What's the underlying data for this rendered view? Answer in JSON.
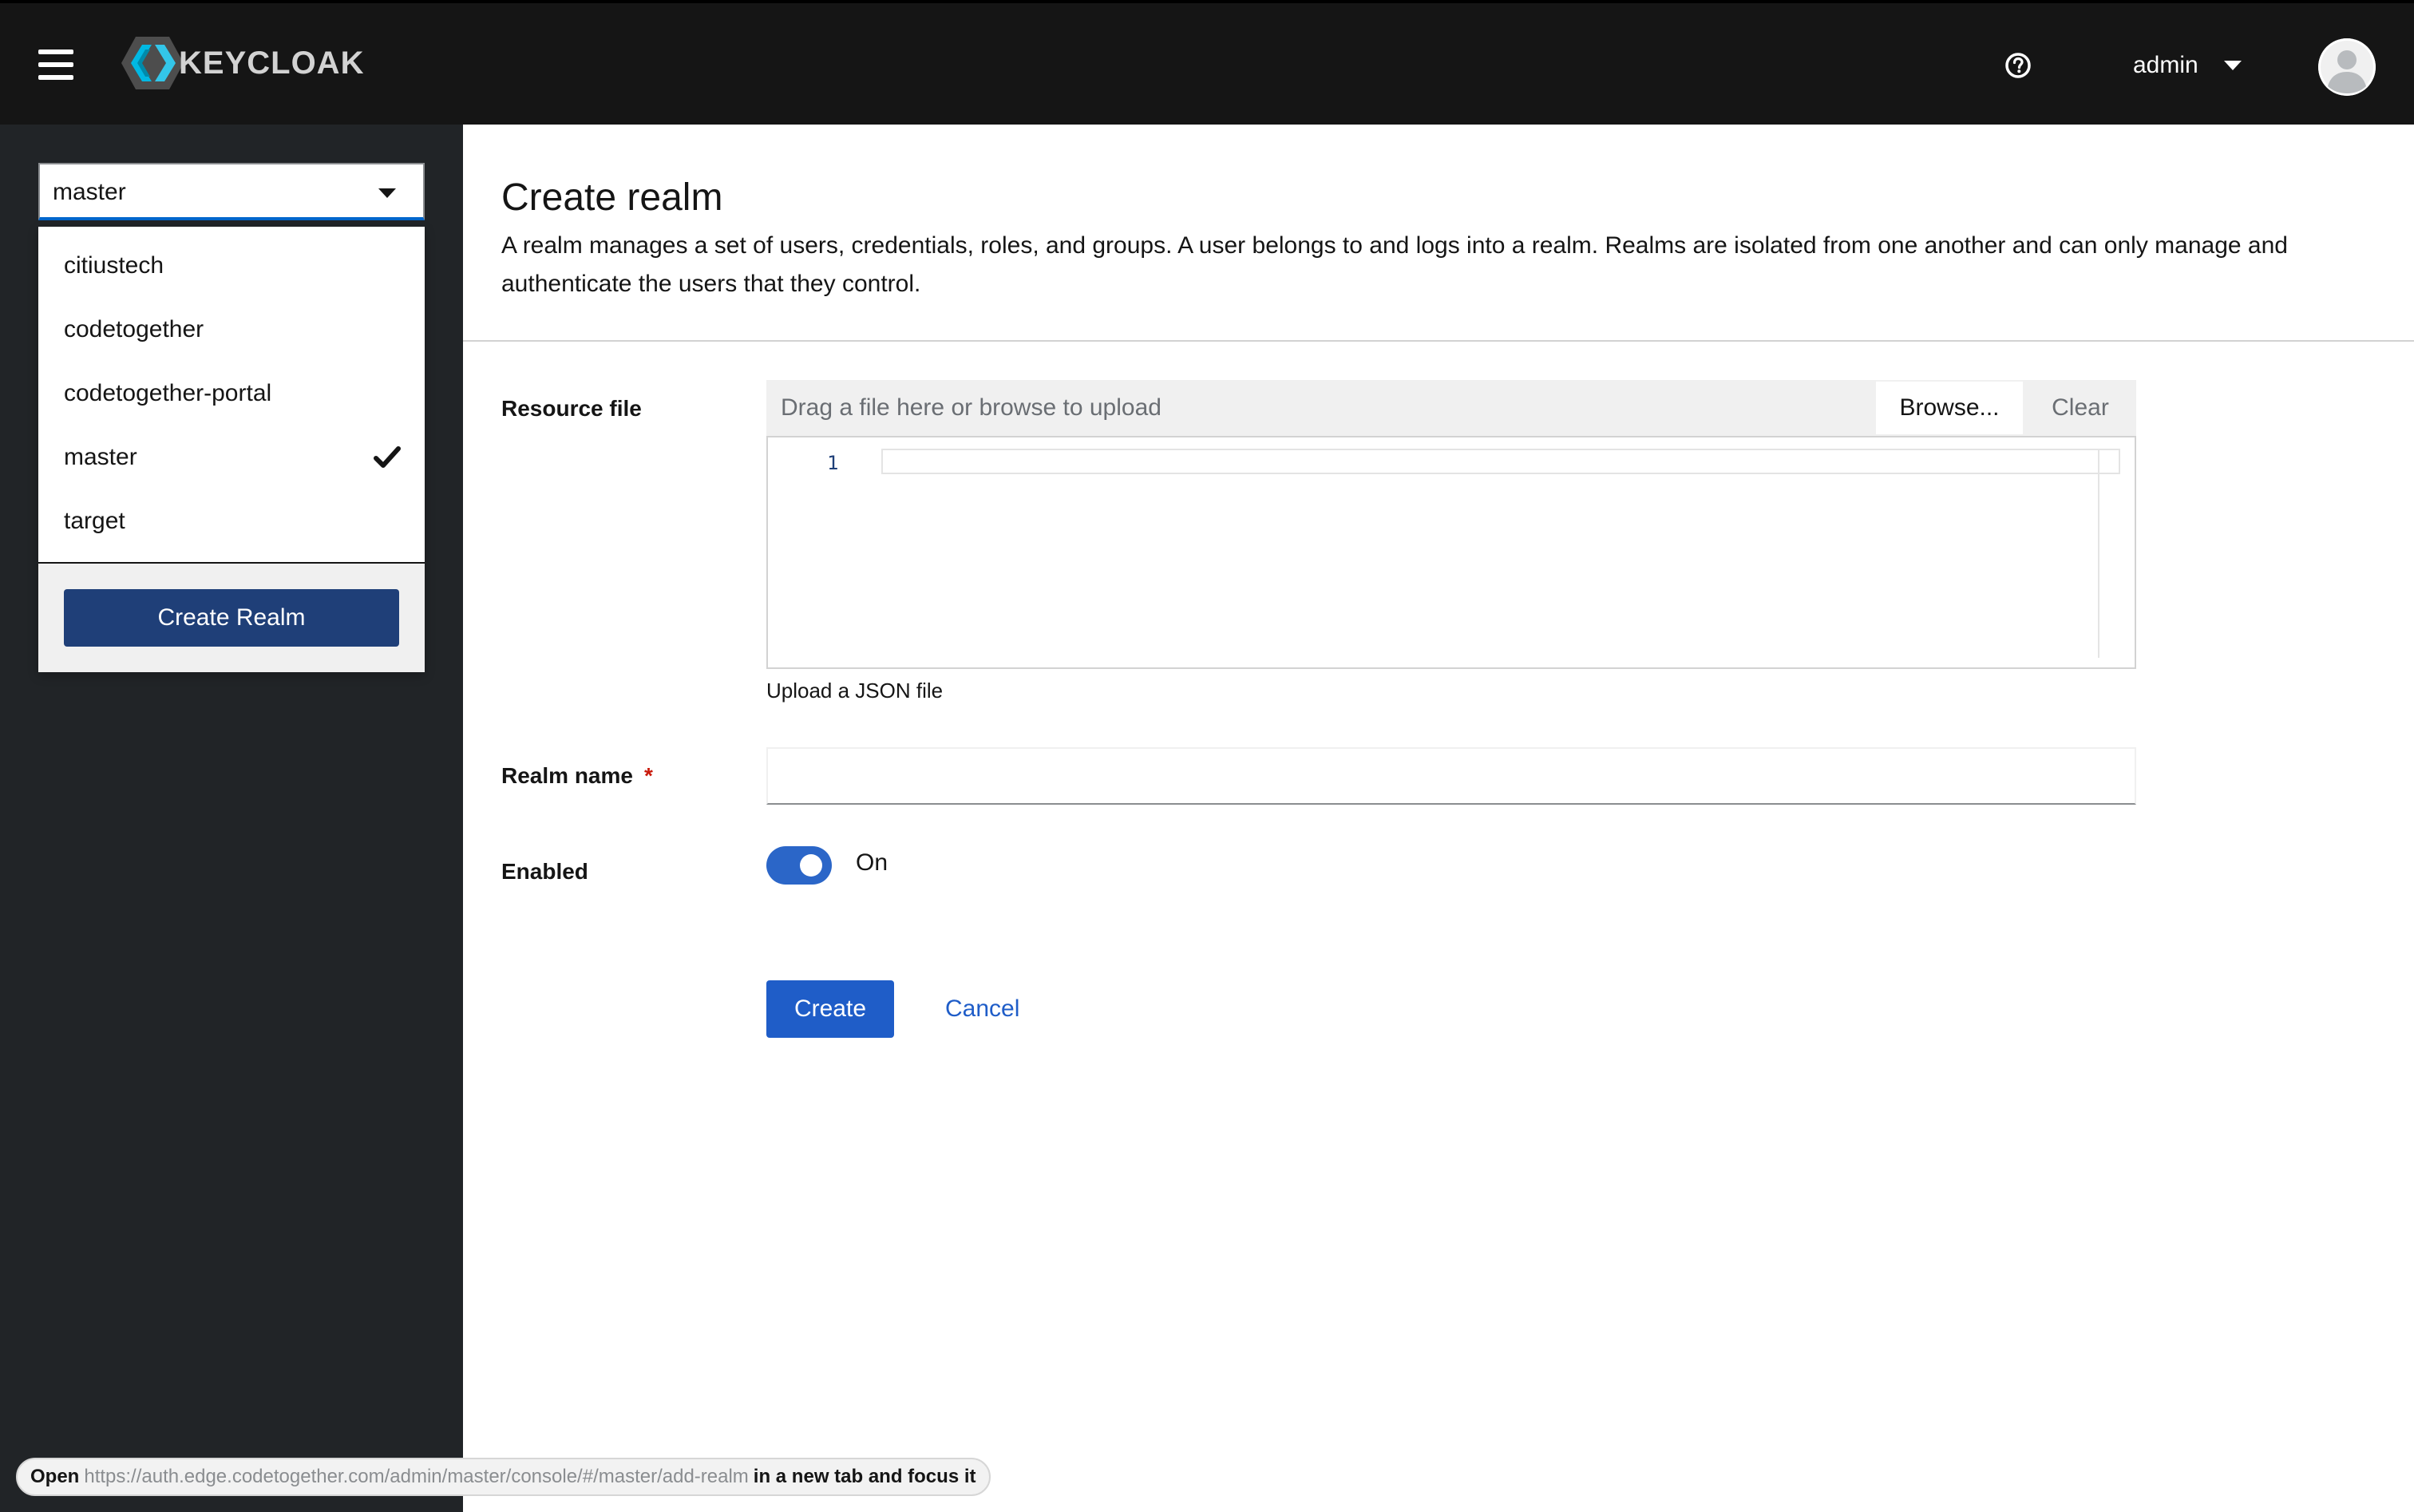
{
  "header": {
    "logo_text": "KEYCLOAK",
    "user": "admin"
  },
  "sidebar": {
    "selected_realm": "master",
    "realms": [
      {
        "label": "citiustech",
        "selected": false
      },
      {
        "label": "codetogether",
        "selected": false
      },
      {
        "label": "codetogether-portal",
        "selected": false
      },
      {
        "label": "master",
        "selected": true
      },
      {
        "label": "target",
        "selected": false
      }
    ],
    "create_realm_label": "Create Realm"
  },
  "page": {
    "title": "Create realm",
    "description": "A realm manages a set of users, credentials, roles, and groups. A user belongs to and logs into a realm. Realms are isolated from one another and can only manage and authenticate the users that they control."
  },
  "form": {
    "resource_file_label": "Resource file",
    "upload_placeholder": "Drag a file here or browse to upload",
    "browse_label": "Browse...",
    "clear_label": "Clear",
    "editor_line_number": "1",
    "upload_helper": "Upload a JSON file",
    "realm_name_label": "Realm name",
    "required_marker": "*",
    "realm_name_value": "",
    "enabled_label": "Enabled",
    "enabled_state": "On",
    "create_label": "Create",
    "cancel_label": "Cancel"
  },
  "status": {
    "prefix": "Open",
    "url": "https://auth.edge.codetogether.com/admin/master/console/#/master/add-realm",
    "suffix": "in a new tab and focus it"
  },
  "colors": {
    "masthead": "#151515",
    "sidebar": "#212427",
    "primary": "#1f5dc8",
    "create_realm_button": "#1f3f78"
  }
}
